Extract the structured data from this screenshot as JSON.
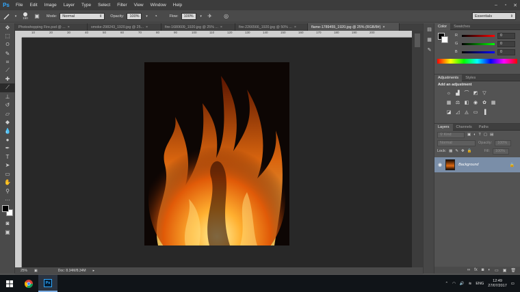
{
  "app": {
    "logo": "Ps"
  },
  "menu": [
    "File",
    "Edit",
    "Image",
    "Layer",
    "Type",
    "Select",
    "Filter",
    "View",
    "Window",
    "Help"
  ],
  "window_controls": [
    "minimize-icon",
    "maximize-icon",
    "close-icon"
  ],
  "options": {
    "brush_size": "150",
    "mode_label": "Mode:",
    "mode_value": "Normal",
    "opacity_label": "Opacity:",
    "opacity_value": "100%",
    "flow_label": "Flow:",
    "flow_value": "100%",
    "workspace": "Essentials"
  },
  "tabs": [
    {
      "label": "Photoshopping Fire.psd @ ..."
    },
    {
      "label": "smoke-298243_1920.jpg @ 25..."
    },
    {
      "label": "fire-1680609_1920.jpg @ 25% ..."
    },
    {
      "label": "fire-2266566_1920.jpg @ 50% ..."
    },
    {
      "label": "flame-1789455_1920.jpg @ 25% (RGB/8#)",
      "active": true
    }
  ],
  "ruler_h": [
    "10",
    "20",
    "30",
    "40",
    "50",
    "60",
    "70",
    "80",
    "90",
    "100",
    "110",
    "120",
    "130",
    "140",
    "150",
    "160",
    "170",
    "180",
    "190",
    "200"
  ],
  "status": {
    "zoom": "25%",
    "doc": "Doc: 8.34M/8.34M"
  },
  "color_panel": {
    "tabs": [
      "Color",
      "Swatches"
    ],
    "channels": [
      {
        "label": "R",
        "value": "0",
        "color": "#ff0000"
      },
      {
        "label": "G",
        "value": "0",
        "color": "#00ff00"
      },
      {
        "label": "B",
        "value": "0",
        "color": "#0000ff"
      }
    ]
  },
  "adjustments_panel": {
    "tabs": [
      "Adjustments",
      "Styles"
    ],
    "heading": "Add an adjustment"
  },
  "layers_panel": {
    "tabs": [
      "Layers",
      "Channels",
      "Paths"
    ],
    "kind_label": "Kind",
    "blend_mode": "Normal",
    "opacity_label": "Opacity:",
    "opacity_value": "100%",
    "lock_label": "Lock:",
    "fill_label": "Fill:",
    "fill_value": "100%",
    "layer_name": "Background"
  },
  "taskbar": {
    "lang": "ENG",
    "time": "12:49",
    "date": "27/07/2017"
  }
}
